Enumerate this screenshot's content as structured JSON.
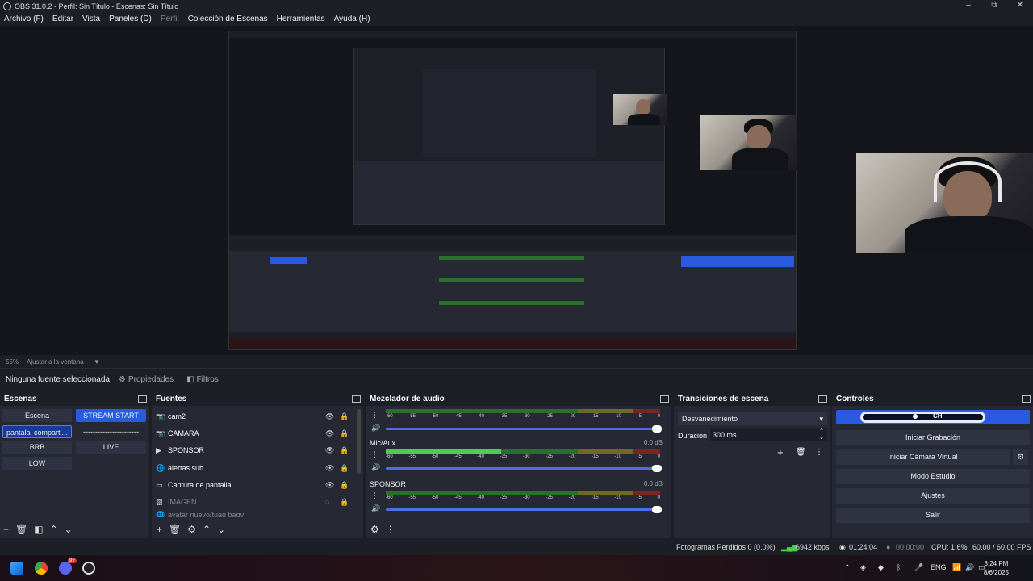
{
  "window": {
    "title": "OBS 31.0.2 - Perfil: Sin Título - Escenas: Sin Título",
    "controls": [
      "–",
      "⧉",
      "✕"
    ]
  },
  "menu": {
    "items": [
      "Archivo (F)",
      "Editar",
      "Vista",
      "Paneles (D)",
      "Perfil",
      "Colección de Escenas",
      "Herramientas",
      "Ayuda (H)"
    ]
  },
  "preview": {
    "zoom": "55%",
    "fit_label": "Ajustar a la ventana"
  },
  "context_bar": {
    "no_source": "Ninguna fuente seleccionada",
    "properties": "Propiedades",
    "filters": "Filtros"
  },
  "scenes": {
    "title": "Escenas",
    "items": [
      {
        "label": "Escena",
        "state": "normal"
      },
      {
        "label": "STREAM START",
        "state": "active"
      },
      {
        "label": "pantalal comparti...",
        "state": "selected"
      },
      {
        "label": "-----------------------",
        "state": "normal"
      },
      {
        "label": "BRB",
        "state": "normal"
      },
      {
        "label": "LIVE",
        "state": "normal"
      },
      {
        "label": "LOW",
        "state": "normal"
      }
    ]
  },
  "sources": {
    "title": "Fuentes",
    "items": [
      {
        "label": "cam2",
        "icon": "camera-icon",
        "dim": false
      },
      {
        "label": "CAMARA",
        "icon": "camera-icon",
        "dim": false
      },
      {
        "label": "SPONSOR",
        "icon": "play-icon",
        "dim": false
      },
      {
        "label": "alertas sub",
        "icon": "globe-icon",
        "dim": false
      },
      {
        "label": "Captura de pantalla",
        "icon": "monitor-icon",
        "dim": false
      },
      {
        "label": "IMAGEN",
        "icon": "image-icon",
        "dim": true
      },
      {
        "label": "avatar nuevo/tuaq bagy",
        "icon": "globe-icon",
        "dim": true
      }
    ]
  },
  "mixer": {
    "title": "Mezclador de audio",
    "ticks": [
      "-60",
      "-55",
      "-50",
      "-45",
      "-40",
      "-35",
      "-30",
      "-25",
      "-20",
      "-15",
      "-10",
      "-5",
      "0"
    ],
    "channels": [
      {
        "name": "",
        "db": "",
        "level": 0
      },
      {
        "name": "Mic/Aux",
        "db": "0.0 dB",
        "level": 0.42
      },
      {
        "name": "SPONSOR",
        "db": "0.0 dB",
        "level": 0
      }
    ]
  },
  "transitions": {
    "title": "Transiciones de escena",
    "selected": "Desvanecimiento",
    "duration_label": "Duración",
    "duration_value": "300 ms"
  },
  "controls": {
    "title": "Controles",
    "logo_text": "CH",
    "buttons": [
      "Iniciar Grabación",
      "Iniciar Cámara Virtual",
      "Modo Estudio",
      "Ajustes",
      "Salir"
    ]
  },
  "status": {
    "dropped": "Fotogramas Perdidos 0 (0.0%)",
    "bitrate": "6942 kbps",
    "stream_time": "01:24:04",
    "rec_time": "00:00:00",
    "cpu": "CPU: 1.6%",
    "fps": "60.00 / 60.00 FPS"
  },
  "taskbar": {
    "badge": "9+",
    "lang": "ENG",
    "time": "3:24 PM",
    "date": "8/6/2025"
  },
  "colors": {
    "accent": "#2a5ae0",
    "panel": "#262833",
    "background": "#1d1f26"
  }
}
